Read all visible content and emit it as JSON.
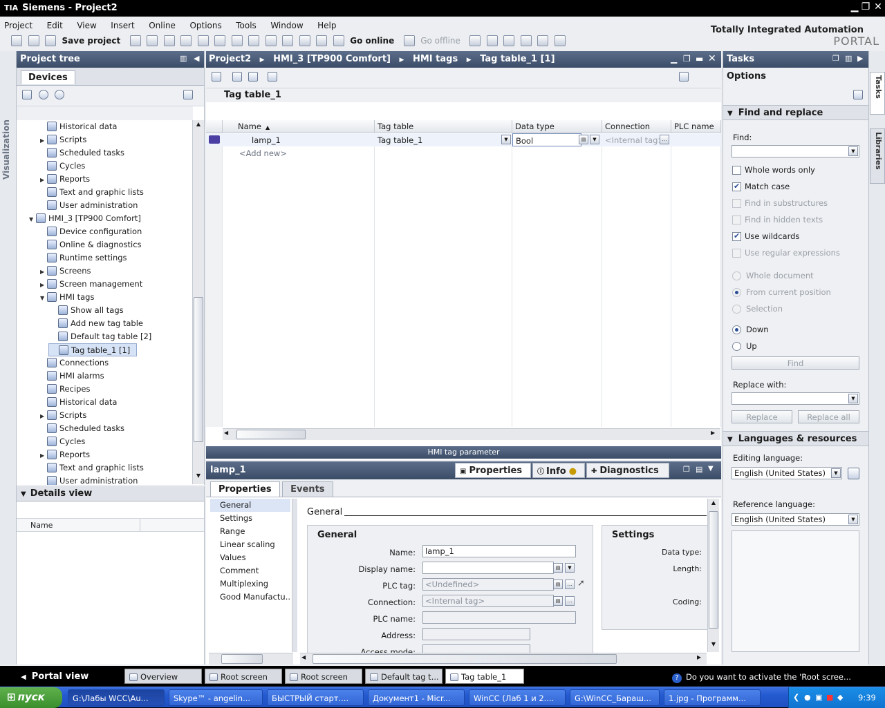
{
  "window": {
    "title": "Siemens  -  Project2",
    "logo": "TIA"
  },
  "menu": [
    "Project",
    "Edit",
    "View",
    "Insert",
    "Online",
    "Options",
    "Tools",
    "Window",
    "Help"
  ],
  "toolbar": {
    "save_project": "Save project",
    "go_online": "Go online",
    "go_offline": "Go offline"
  },
  "brand": {
    "line1": "Totally Integrated Automation",
    "line2": "PORTAL"
  },
  "left_strip": {
    "label": "Visualization"
  },
  "project_tree": {
    "title": "Project tree",
    "tab": "Devices",
    "items": [
      {
        "label": "Historical data",
        "indent": 2,
        "expander": ""
      },
      {
        "label": "Scripts",
        "indent": 2,
        "expander": "▶"
      },
      {
        "label": "Scheduled tasks",
        "indent": 2,
        "expander": ""
      },
      {
        "label": "Cycles",
        "indent": 2,
        "expander": ""
      },
      {
        "label": "Reports",
        "indent": 2,
        "expander": "▶"
      },
      {
        "label": "Text and graphic lists",
        "indent": 2,
        "expander": ""
      },
      {
        "label": "User administration",
        "indent": 2,
        "expander": ""
      },
      {
        "label": "HMI_3 [TP900 Comfort]",
        "indent": 1,
        "expander": "▼"
      },
      {
        "label": "Device configuration",
        "indent": 2,
        "expander": ""
      },
      {
        "label": "Online & diagnostics",
        "indent": 2,
        "expander": ""
      },
      {
        "label": "Runtime settings",
        "indent": 2,
        "expander": ""
      },
      {
        "label": "Screens",
        "indent": 2,
        "expander": "▶"
      },
      {
        "label": "Screen management",
        "indent": 2,
        "expander": "▶"
      },
      {
        "label": "HMI tags",
        "indent": 2,
        "expander": "▼"
      },
      {
        "label": "Show all tags",
        "indent": 3,
        "expander": ""
      },
      {
        "label": "Add new tag table",
        "indent": 3,
        "expander": ""
      },
      {
        "label": "Default tag table [2]",
        "indent": 3,
        "expander": ""
      },
      {
        "label": "Tag table_1 [1]",
        "indent": 3,
        "expander": "",
        "selected": true
      },
      {
        "label": "Connections",
        "indent": 2,
        "expander": ""
      },
      {
        "label": "HMI alarms",
        "indent": 2,
        "expander": ""
      },
      {
        "label": "Recipes",
        "indent": 2,
        "expander": ""
      },
      {
        "label": "Historical data",
        "indent": 2,
        "expander": ""
      },
      {
        "label": "Scripts",
        "indent": 2,
        "expander": "▶"
      },
      {
        "label": "Scheduled tasks",
        "indent": 2,
        "expander": ""
      },
      {
        "label": "Cycles",
        "indent": 2,
        "expander": ""
      },
      {
        "label": "Reports",
        "indent": 2,
        "expander": "▶"
      },
      {
        "label": "Text and graphic lists",
        "indent": 2,
        "expander": ""
      },
      {
        "label": "User administration",
        "indent": 2,
        "expander": ""
      }
    ]
  },
  "details_view": {
    "title": "Details view",
    "column": "Name"
  },
  "editor": {
    "breadcrumb": [
      "Project2",
      "HMI_3 [TP900 Comfort]",
      "HMI tags",
      "Tag table_1 [1]"
    ],
    "table_title": "Tag table_1",
    "columns": [
      "Name",
      "Tag table",
      "Data type",
      "Connection",
      "PLC name"
    ],
    "rows": [
      {
        "name": "lamp_1",
        "tag_table": "Tag table_1",
        "data_type": "Bool",
        "connection": "<Internal tag>",
        "plc_name": ""
      }
    ],
    "add_new": "<Add new>",
    "footer": "HMI tag parameter"
  },
  "inspector": {
    "object": "lamp_1",
    "tabs": [
      "Properties",
      "Info",
      "Diagnostics"
    ],
    "subtabs": [
      "Properties",
      "Events"
    ],
    "nav": [
      "General",
      "Settings",
      "Range",
      "Linear scaling",
      "Values",
      "Comment",
      "Multiplexing",
      "Good Manufactu..."
    ],
    "section": "General",
    "general_title": "General",
    "settings_title": "Settings",
    "fields": [
      {
        "label": "Name:",
        "value": ""
      },
      {
        "label": "Display name:",
        "value": ""
      },
      {
        "label": "PLC tag:",
        "value": ""
      },
      {
        "label": "Connection:",
        "value": ""
      },
      {
        "label": "PLC name:",
        "value": ""
      },
      {
        "label": "Address:",
        "value": ""
      },
      {
        "label": "Access mode:",
        "value": ""
      }
    ],
    "field_values": {
      "name": "lamp_1",
      "plc_tag": "<Undefined>",
      "connection": "<Internal tag>"
    },
    "settings_fields": [
      "Data type:",
      "Length:",
      "Coding:"
    ]
  },
  "tasks": {
    "title": "Tasks",
    "options": "Options",
    "find_replace": {
      "title": "Find and replace",
      "find_label": "Find:",
      "checks": [
        {
          "label": "Whole words only",
          "checked": false,
          "enabled": true
        },
        {
          "label": "Match case",
          "checked": true,
          "enabled": true
        },
        {
          "label": "Find in substructures",
          "checked": false,
          "enabled": false
        },
        {
          "label": "Find in hidden texts",
          "checked": false,
          "enabled": false
        },
        {
          "label": "Use wildcards",
          "checked": true,
          "enabled": true
        },
        {
          "label": "Use regular expressions",
          "checked": false,
          "enabled": false
        }
      ],
      "radios1": [
        {
          "label": "Whole document",
          "checked": false
        },
        {
          "label": "From current position",
          "checked": true
        },
        {
          "label": "Selection",
          "checked": false
        }
      ],
      "radios2": [
        {
          "label": "Down",
          "checked": true
        },
        {
          "label": "Up",
          "checked": false
        }
      ],
      "find_button": "Find",
      "replace_label": "Replace with:",
      "replace_button": "Replace",
      "replace_all_button": "Replace all"
    },
    "languages": {
      "title": "Languages & resources",
      "editing_label": "Editing language:",
      "editing_value": "English (United States)",
      "reference_label": "Reference language:",
      "reference_value": "English (United States)"
    }
  },
  "right_strip": [
    "Tasks",
    "Libraries"
  ],
  "statusbar": {
    "portal_view": "Portal view",
    "tabs": [
      "Overview",
      "Root screen",
      "Root screen",
      "Default tag t...",
      "Tag table_1"
    ],
    "message": "Do you want to activate the 'Root scree..."
  },
  "taskbar": {
    "start": "пуск",
    "items": [
      "G:\\Лабы WCC\\Au...",
      "Skype™ - angelin...",
      "БЫСТРЫЙ старт....",
      "Документ1 - Micr...",
      "WinCC (Лаб 1 и 2....",
      "G:\\WinCC_Бараш...",
      "1.jpg - Программ..."
    ],
    "clock": "9:39"
  }
}
